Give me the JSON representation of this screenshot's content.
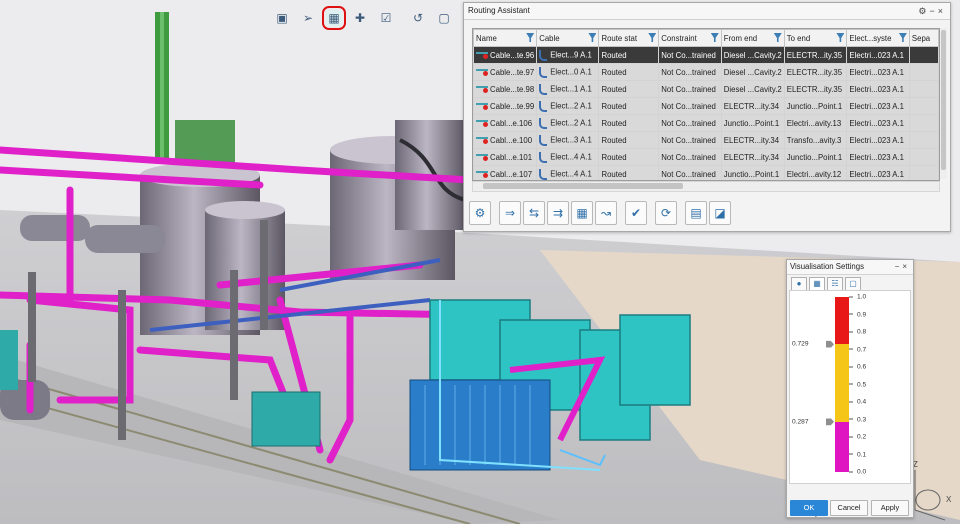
{
  "toolbar": {
    "icons": [
      "view-icon",
      "pointer-icon",
      "routing-assistant-icon",
      "route-grid-icon",
      "shield-check-icon",
      "hook-icon",
      "part-icon",
      "bracket-icon",
      "settings-gear-icon"
    ]
  },
  "routing_assistant": {
    "title": "Routing Assistant",
    "columns": [
      "Name",
      "Cable",
      "Route stat",
      "Constraint",
      "From end",
      "To end",
      "Elect...syste",
      "Sepa"
    ],
    "rows": [
      {
        "name": "Cable...te.96",
        "cable": "Elect...9 A.1",
        "route": "Routed",
        "constraint": "Not Co...trained",
        "from": "Diesel ...Cavity.2",
        "to": "ELECTR...ity.35",
        "system": "Electri...023 A.1",
        "selected": true
      },
      {
        "name": "Cable...te.97",
        "cable": "Elect...0 A.1",
        "route": "Routed",
        "constraint": "Not Co...trained",
        "from": "Diesel ...Cavity.2",
        "to": "ELECTR...ity.35",
        "system": "Electri...023 A.1"
      },
      {
        "name": "Cable...te.98",
        "cable": "Elect...1 A.1",
        "route": "Routed",
        "constraint": "Not Co...trained",
        "from": "Diesel ...Cavity.2",
        "to": "ELECTR...ity.35",
        "system": "Electri...023 A.1"
      },
      {
        "name": "Cable...te.99",
        "cable": "Elect...2 A.1",
        "route": "Routed",
        "constraint": "Not Co...trained",
        "from": "ELECTR...ity.34",
        "to": "Junctio...Point.1",
        "system": "Electri...023 A.1"
      },
      {
        "name": "Cabl...e.106",
        "cable": "Elect...2 A.1",
        "route": "Routed",
        "constraint": "Not Co...trained",
        "from": "Junctio...Point.1",
        "to": "Electri...avity.13",
        "system": "Electri...023 A.1"
      },
      {
        "name": "Cabl...e.100",
        "cable": "Elect...3 A.1",
        "route": "Routed",
        "constraint": "Not Co...trained",
        "from": "ELECTR...ity.34",
        "to": "Transfo...avity.3",
        "system": "Electri...023 A.1"
      },
      {
        "name": "Cabl...e.101",
        "cable": "Elect...4 A.1",
        "route": "Routed",
        "constraint": "Not Co...trained",
        "from": "ELECTR...ity.34",
        "to": "Junctio...Point.1",
        "system": "Electri...023 A.1"
      },
      {
        "name": "Cabl...e.107",
        "cable": "Elect...4 A.1",
        "route": "Routed",
        "constraint": "Not Co...trained",
        "from": "Junctio...Point.1",
        "to": "Electri...avity.12",
        "system": "Electri...023 A.1"
      }
    ],
    "action_icons": [
      "configure-icon",
      "route-icon",
      "reroute-icon",
      "unroute-icon",
      "fill-icon",
      "split-icon",
      "validate-icon",
      "refresh-icon",
      "report-icon",
      "export-icon"
    ]
  },
  "visualisation": {
    "title": "Visualisation Settings",
    "tab_icons": [
      "filter-icon",
      "color-icon",
      "chart-icon",
      "section-icon"
    ],
    "ticks": [
      "1.0",
      "0.9",
      "0.8",
      "0.7",
      "0.6",
      "0.5",
      "0.4",
      "0.3",
      "0.2",
      "0.1",
      "0.0"
    ],
    "thresholds": [
      {
        "label": "0.729",
        "value": 0.729
      },
      {
        "label": "0.287",
        "value": 0.287
      }
    ],
    "colors": {
      "high": "#e81818",
      "mid": "#f5c518",
      "low": "#e015c2"
    },
    "ok_label": "OK",
    "cancel_label": "Cancel",
    "apply_label": "Apply"
  },
  "compass": {
    "z": "Z",
    "x": "X"
  }
}
